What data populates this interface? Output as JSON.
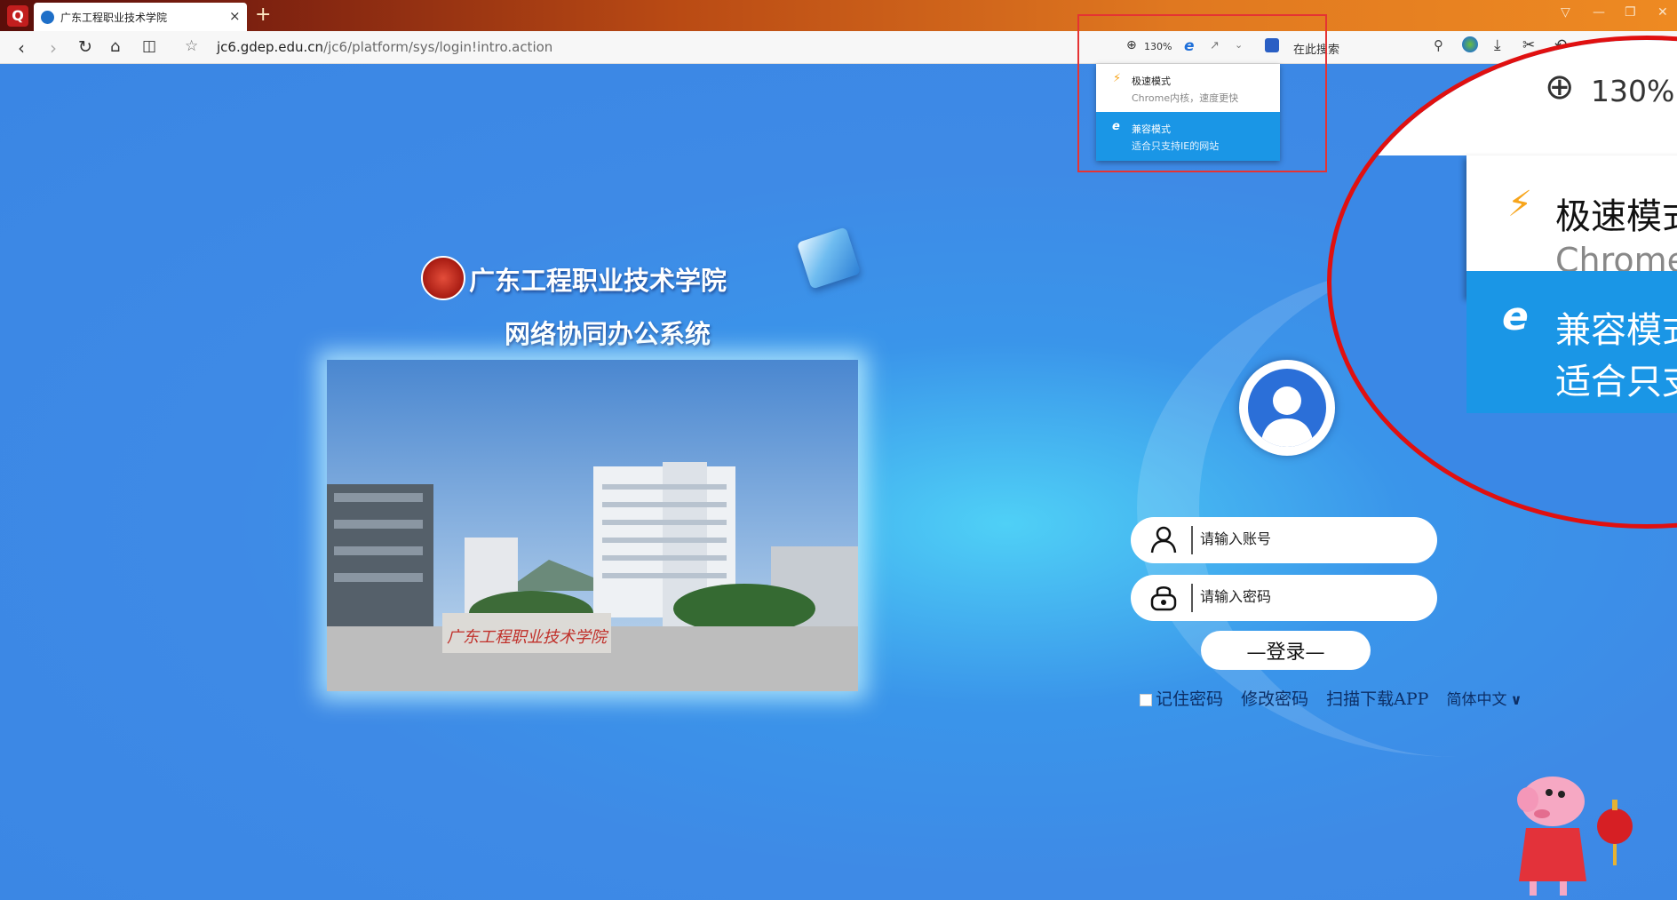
{
  "browser": {
    "tab_title": "广东工程职业技术学院",
    "tab_close": "×",
    "new_tab": "+",
    "url_host": "jc6.gdep.edu.cn",
    "url_path": "/jc6/platform/sys/login!intro.action",
    "zoom": "130%",
    "search_hint": "在此搜索"
  },
  "mode_menu": {
    "items": [
      {
        "title": "极速模式",
        "subtitle": "Chrome内核，速度更快",
        "selected": false
      },
      {
        "title": "兼容模式",
        "subtitle": "适合只支持IE的网站",
        "selected": true
      }
    ]
  },
  "zoom_inset": {
    "zoom": "130%",
    "speed_title": "极速模式",
    "speed_sub": "Chrome",
    "compat_title": "兼容模式",
    "compat_sub": "适合只支"
  },
  "login_page": {
    "school_name": "广东工程职业技术学院",
    "system_name": "网络协同办公系统",
    "photo_sign": "广东工程职业技术学院",
    "account_placeholder": "请输入账号",
    "password_placeholder": "请输入密码",
    "login_label": "—登录—",
    "remember_label": "记住密码",
    "change_password_label": "修改密码",
    "download_app_label": "扫描下载APP",
    "language_label": "简体中文"
  },
  "colors": {
    "page_blue": "#3a86e4",
    "menu_selected": "#1a96e6",
    "highlight_red": "#e53333"
  }
}
